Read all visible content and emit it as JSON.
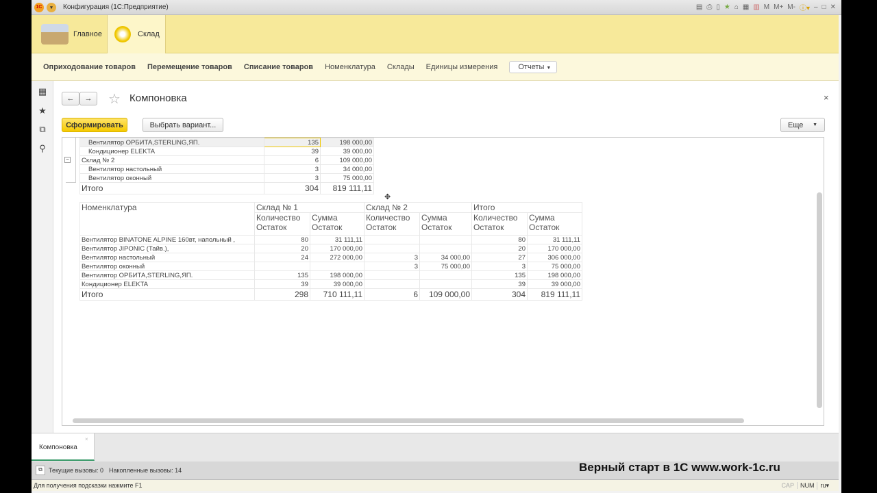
{
  "window": {
    "title": "Конфигурация (1С:Предприятие)",
    "app_icon": "1С",
    "toolbar_icons": [
      "save-icon",
      "print-icon",
      "preview-icon",
      "favorites-icon",
      "home-icon",
      "calculator-icon",
      "calendar-icon"
    ],
    "mem_buttons": [
      "M",
      "M+",
      "M-"
    ]
  },
  "sections": [
    {
      "label": "Главное"
    },
    {
      "label": "Склад"
    }
  ],
  "nav": {
    "items": [
      "Оприходование товаров",
      "Перемещение товаров",
      "Списание товаров",
      "Номенклатура",
      "Склады",
      "Единицы измерения"
    ],
    "reports_label": "Отчеты"
  },
  "form": {
    "title": "Компоновка",
    "generate_label": "Сформировать",
    "variant_label": "Выбрать вариант...",
    "more_label": "Еще",
    "close": "×"
  },
  "report_top": {
    "rows": [
      {
        "name": "Вентилятор ОРБИТА,STERLING,ЯП.",
        "qty": "135",
        "sum": "198 000,00"
      },
      {
        "name": "Кондиционер ELEKTA",
        "qty": "39",
        "sum": "39 000,00"
      },
      {
        "name": "Склад № 2",
        "qty": "6",
        "sum": "109 000,00"
      },
      {
        "name": "Вентилятор настольный",
        "qty": "3",
        "sum": "34 000,00"
      },
      {
        "name": "Вентилятор оконный",
        "qty": "3",
        "sum": "75 000,00"
      }
    ],
    "total": {
      "name": "Итого",
      "qty": "304",
      "sum": "819 111,11"
    }
  },
  "report_cross": {
    "header": {
      "nomenclature": "Номенклатура",
      "groups": [
        "Склад № 1",
        "Склад № 2",
        "Итого"
      ],
      "qty": "Количество Остаток",
      "sum": "Сумма Остаток"
    },
    "rows": [
      [
        "Вентилятор BINATONE ALPINE 160вт, напольный ,",
        "80",
        "31 111,11",
        "",
        "",
        "80",
        "31 111,11"
      ],
      [
        "Вентилятор JIPONIC (Тайв.),",
        "20",
        "170 000,00",
        "",
        "",
        "20",
        "170 000,00"
      ],
      [
        "Вентилятор настольный",
        "24",
        "272 000,00",
        "3",
        "34 000,00",
        "27",
        "306 000,00"
      ],
      [
        "Вентилятор оконный",
        "",
        "",
        "3",
        "75 000,00",
        "3",
        "75 000,00"
      ],
      [
        "Вентилятор ОРБИТА,STERLING,ЯП.",
        "135",
        "198 000,00",
        "",
        "",
        "135",
        "198 000,00"
      ],
      [
        "Кондиционер ELEKTA",
        "39",
        "39 000,00",
        "",
        "",
        "39",
        "39 000,00"
      ]
    ],
    "total": [
      "Итого",
      "298",
      "710 111,11",
      "6",
      "109 000,00",
      "304",
      "819 111,11"
    ]
  },
  "tabs": [
    {
      "label": "Компоновка"
    }
  ],
  "status": {
    "current": "Текущие вызовы: 0",
    "accumulated": "Накопленные вызовы: 14"
  },
  "hint": "Для получения подсказки нажмите F1",
  "indicators": [
    "CAP",
    "NUM",
    "ru"
  ],
  "watermark": "Верный старт в 1С www.work-1c.ru"
}
